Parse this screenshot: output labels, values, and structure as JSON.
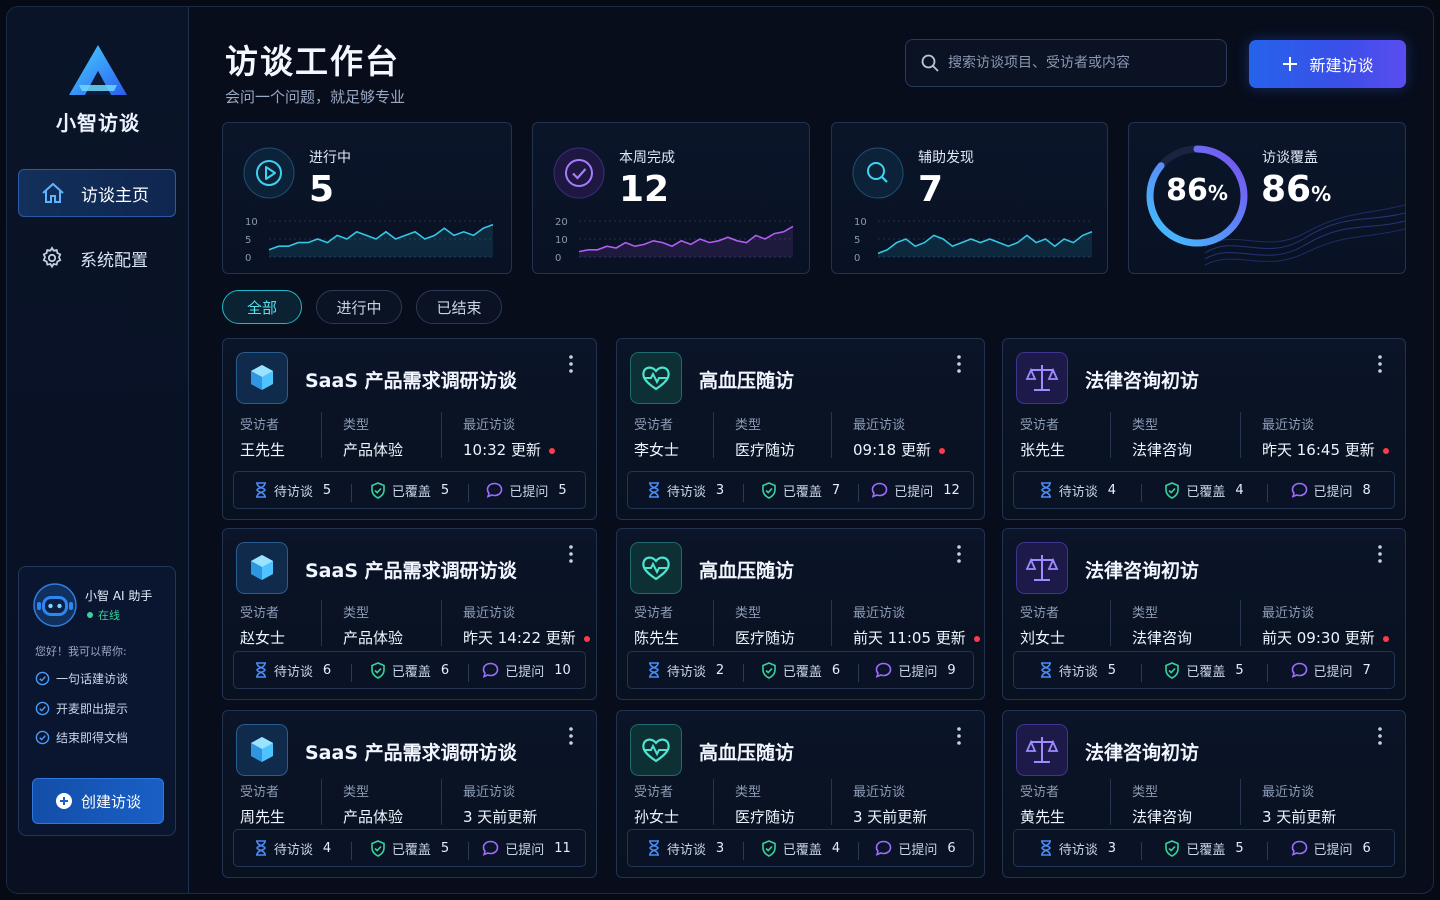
{
  "app": {
    "name": "小智访谈"
  },
  "nav": [
    {
      "label": "访谈主页",
      "icon": "home-icon",
      "active": true
    },
    {
      "label": "系统配置",
      "icon": "gear-icon",
      "active": false
    }
  ],
  "header": {
    "title": "访谈工作台",
    "subtitle": "会问一个问题，就足够专业",
    "search_placeholder": "搜索访谈项目、受访者或内容",
    "new_button": "新建访谈"
  },
  "stats": [
    {
      "label": "进行中",
      "value": "5",
      "icon": "play-circle-icon",
      "color": "#34c6e6",
      "y_ticks": [
        "10",
        "5",
        "0"
      ],
      "ymax": 10,
      "series": [
        2,
        3,
        3,
        4,
        4,
        5,
        4,
        6,
        5,
        7,
        6,
        5,
        7,
        5,
        6,
        7,
        5,
        6,
        8,
        6,
        7,
        6,
        8,
        9
      ]
    },
    {
      "label": "本周完成",
      "value": "12",
      "icon": "check-circle-icon",
      "color": "#b25cf0",
      "y_ticks": [
        "20",
        "10",
        "0"
      ],
      "ymax": 20,
      "series": [
        3,
        4,
        4,
        6,
        5,
        8,
        6,
        7,
        9,
        8,
        6,
        9,
        7,
        10,
        8,
        9,
        11,
        9,
        8,
        12,
        10,
        13,
        14,
        17
      ]
    },
    {
      "label": "辅助发现",
      "value": "7",
      "icon": "search-circle-icon",
      "color": "#34c6e6",
      "y_ticks": [
        "10",
        "5",
        "0"
      ],
      "ymax": 10,
      "series": [
        1,
        2,
        4,
        5,
        3,
        4,
        6,
        5,
        3,
        4,
        5,
        4,
        5,
        4,
        3,
        4,
        6,
        4,
        5,
        3,
        5,
        4,
        6,
        7
      ]
    },
    {
      "label": "访谈覆盖",
      "value": "86",
      "unit": "%",
      "ring_percent": 86,
      "color": "#5b6cf5"
    }
  ],
  "filters": [
    {
      "label": "全部",
      "active": true
    },
    {
      "label": "进行中",
      "active": false
    },
    {
      "label": "已结束",
      "active": false
    }
  ],
  "labels": {
    "interviewee": "受访者",
    "type": "类型",
    "latest": "最近访谈",
    "pending": "待访谈",
    "covered": "已覆盖",
    "asked": "已提问"
  },
  "projects": [
    {
      "title": "SaaS 产品需求调研访谈",
      "kind": "saas",
      "interviewee": "王先生",
      "type": "产品体验",
      "latest": "10:32 更新",
      "new": true,
      "pending": "5",
      "covered": "5",
      "asked": "5"
    },
    {
      "title": "高血压随访",
      "kind": "health",
      "interviewee": "李女士",
      "type": "医疗随访",
      "latest": "09:18 更新",
      "new": true,
      "pending": "3",
      "covered": "7",
      "asked": "12"
    },
    {
      "title": "法律咨询初访",
      "kind": "law",
      "interviewee": "张先生",
      "type": "法律咨询",
      "latest": "昨天 16:45 更新",
      "new": true,
      "pending": "4",
      "covered": "4",
      "asked": "8"
    },
    {
      "title": "SaaS 产品需求调研访谈",
      "kind": "saas",
      "interviewee": "赵女士",
      "type": "产品体验",
      "latest": "昨天 14:22 更新",
      "new": true,
      "pending": "6",
      "covered": "6",
      "asked": "10"
    },
    {
      "title": "高血压随访",
      "kind": "health",
      "interviewee": "陈先生",
      "type": "医疗随访",
      "latest": "前天 11:05 更新",
      "new": true,
      "pending": "2",
      "covered": "6",
      "asked": "9"
    },
    {
      "title": "法律咨询初访",
      "kind": "law",
      "interviewee": "刘女士",
      "type": "法律咨询",
      "latest": "前天 09:30 更新",
      "new": true,
      "pending": "5",
      "covered": "5",
      "asked": "7"
    },
    {
      "title": "SaaS 产品需求调研访谈",
      "kind": "saas",
      "interviewee": "周先生",
      "type": "产品体验",
      "latest": "3 天前更新",
      "new": false,
      "pending": "4",
      "covered": "5",
      "asked": "11"
    },
    {
      "title": "高血压随访",
      "kind": "health",
      "interviewee": "孙女士",
      "type": "医疗随访",
      "latest": "3 天前更新",
      "new": false,
      "pending": "3",
      "covered": "4",
      "asked": "6"
    },
    {
      "title": "法律咨询初访",
      "kind": "law",
      "interviewee": "黄先生",
      "type": "法律咨询",
      "latest": "3 天前更新",
      "new": false,
      "pending": "3",
      "covered": "5",
      "asked": "6"
    }
  ],
  "assistant": {
    "name": "小智 AI 助手",
    "status": "在线",
    "intro": "您好！我可以帮你:",
    "features": [
      "一句话建访谈",
      "开麦即出提示",
      "结束即得文档"
    ],
    "button": "创建访谈"
  },
  "colors": {
    "accent": "#2563eb",
    "teal": "#1fb8c8",
    "purple": "#8b5cf6",
    "alert": "#ff3a4a",
    "online": "#37d39a"
  }
}
